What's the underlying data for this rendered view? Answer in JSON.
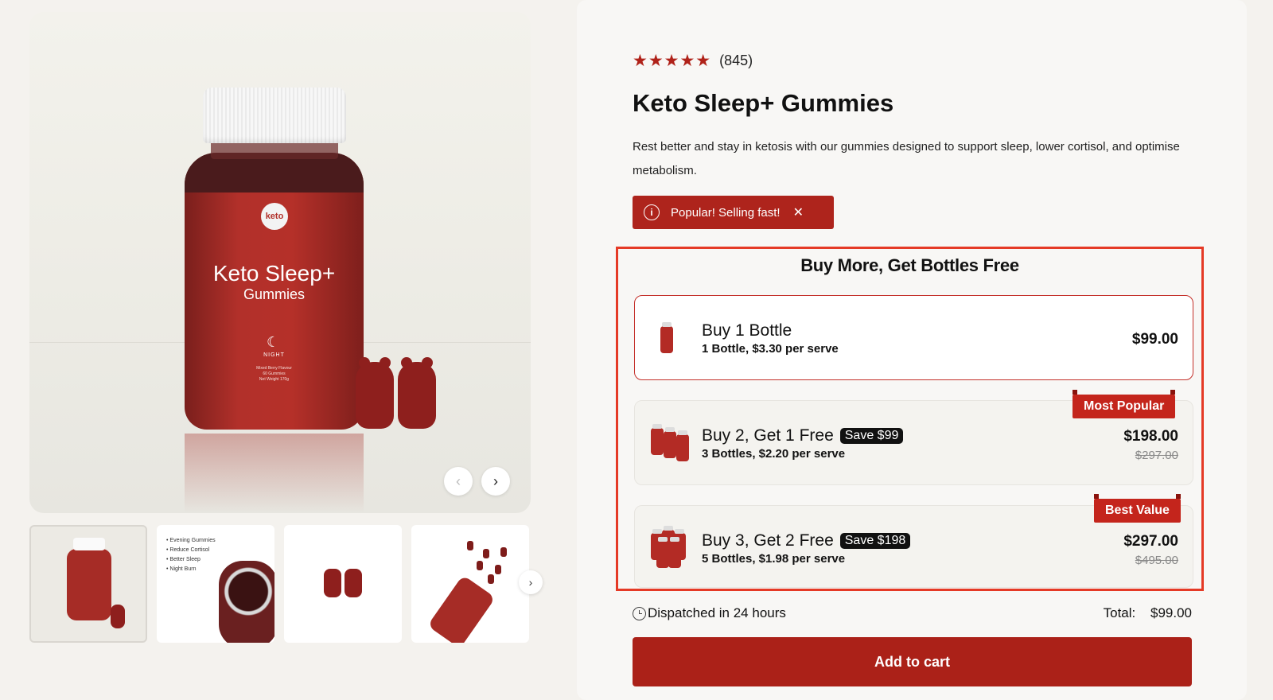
{
  "product": {
    "rating_stars": "★★★★★",
    "rating_count": "(845)",
    "title": "Keto Sleep+ Gummies",
    "description": "Rest better and stay in ketosis with our gummies designed to support sleep, lower cortisol, and optimise metabolism.",
    "alert_text": "Popular! Selling fast!",
    "alert_close": "✕",
    "accent_color": "#ae241c"
  },
  "gallery": {
    "jar_logo": "keto",
    "jar_name_line1": "Keto Sleep+",
    "jar_name_line2": "Gummies",
    "jar_moon": "☾",
    "jar_night": "NIGHT",
    "jar_small_print": "Mixed Berry Flavour\n60 Gummies\nNet Weight 170g",
    "prev_icon": "‹",
    "next_icon": "›",
    "thumb_next_icon": "›",
    "thumb2_list": [
      "• Evening Gummies",
      "• Reduce Cortisol",
      "• Better Sleep",
      "• Night Burn"
    ]
  },
  "bundles": {
    "title": "Buy More, Get Bottles Free",
    "options": [
      {
        "name": "Buy 1 Bottle",
        "badge": "",
        "sub": "1 Bottle, $3.30 per serve",
        "price": "$99.00",
        "old_price": "",
        "ribbon": "",
        "selected": true
      },
      {
        "name": "Buy 2, Get 1 Free",
        "badge": "Save $99",
        "sub": "3 Bottles, $2.20 per serve",
        "price": "$198.00",
        "old_price": "$297.00",
        "ribbon": "Most Popular",
        "selected": false
      },
      {
        "name": "Buy 3, Get 2 Free",
        "badge": "Save $198",
        "sub": "5 Bottles, $1.98 per serve",
        "price": "$297.00",
        "old_price": "$495.00",
        "ribbon": "Best Value",
        "selected": false
      }
    ]
  },
  "footer": {
    "dispatch": "Dispatched in 24 hours",
    "total_label": "Total:",
    "total_value": "$99.00",
    "add_to_cart": "Add to cart"
  }
}
